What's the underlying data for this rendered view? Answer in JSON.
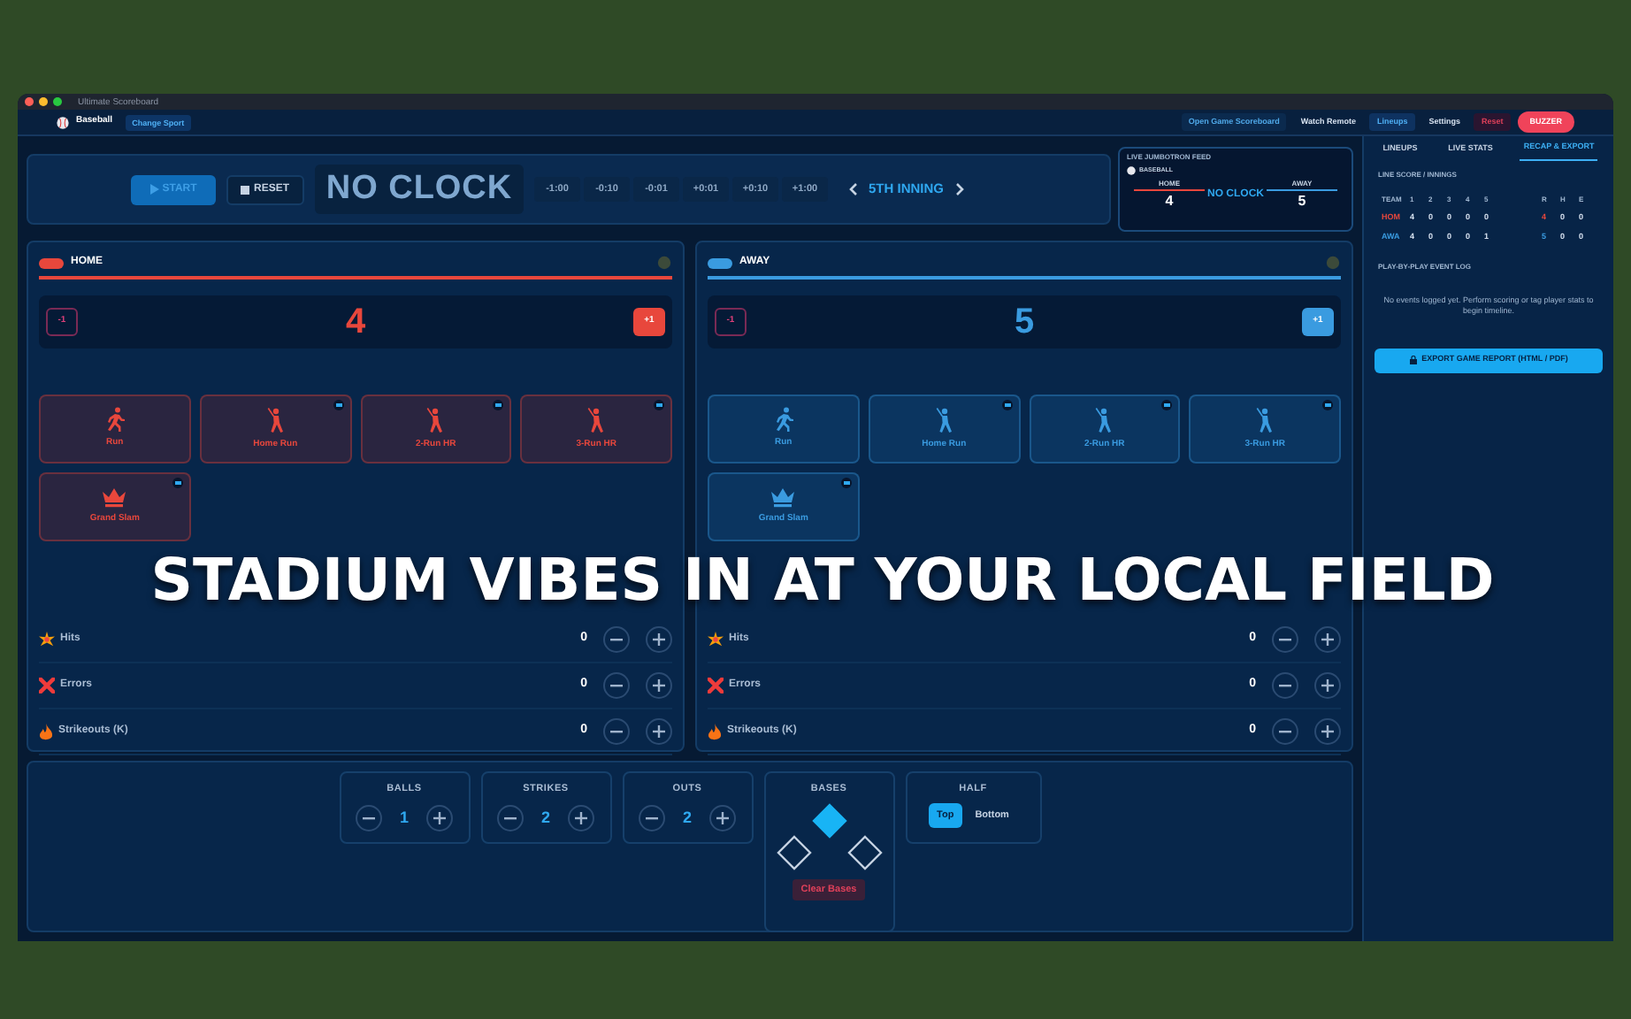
{
  "window": {
    "title": "Ultimate Scoreboard"
  },
  "top_bar": {
    "sport": "Baseball",
    "change_sport": "Change Sport",
    "buttons": [
      {
        "label": "Open Game Scoreboard",
        "kind": "link",
        "selected": false
      },
      {
        "label": "Watch Remote",
        "kind": "plain",
        "selected": false
      },
      {
        "label": "Lineups",
        "kind": "plain",
        "selected": true
      },
      {
        "label": "Settings",
        "kind": "plain",
        "selected": false
      },
      {
        "label": "Reset",
        "kind": "danger",
        "selected": false
      },
      {
        "label": "BUZZER",
        "kind": "buzzer",
        "selected": false
      }
    ]
  },
  "clock": {
    "start": "START",
    "reset": "RESET",
    "display": "NO CLOCK",
    "adjust": [
      "-1:00",
      "-0:10",
      "-0:01",
      "+0:01",
      "+0:10",
      "+1:00"
    ],
    "period": "5TH INNING"
  },
  "jumbotron": {
    "title": "LIVE JUMBOTRON FEED",
    "sport": "BASEBALL",
    "home_label": "HOME",
    "home_score": "4",
    "clock": "NO CLOCK",
    "away_label": "AWAY",
    "away_score": "5"
  },
  "teams": [
    {
      "name": "HOME",
      "color": "#e8473c",
      "score": "4",
      "minus": "-1",
      "plus": "+1",
      "actions": [
        {
          "label": "Run",
          "kind": "runner",
          "video": false
        },
        {
          "label": "Home Run",
          "kind": "batter",
          "video": true
        },
        {
          "label": "2-Run HR",
          "kind": "batter",
          "video": true
        },
        {
          "label": "3-Run HR",
          "kind": "batter",
          "video": true
        },
        {
          "label": "Grand Slam",
          "kind": "crown",
          "video": true
        }
      ],
      "stats": [
        {
          "label": "Hits",
          "kind": "hits",
          "value": "0"
        },
        {
          "label": "Errors",
          "kind": "errors",
          "value": "0"
        },
        {
          "label": "Strikeouts (K)",
          "kind": "strikeouts",
          "value": "0"
        }
      ]
    },
    {
      "name": "AWAY",
      "color": "#3a9be0",
      "score": "5",
      "minus": "-1",
      "plus": "+1",
      "actions": [
        {
          "label": "Run",
          "kind": "runner",
          "video": false
        },
        {
          "label": "Home Run",
          "kind": "batter",
          "video": true
        },
        {
          "label": "2-Run HR",
          "kind": "batter",
          "video": true
        },
        {
          "label": "3-Run HR",
          "kind": "batter",
          "video": true
        },
        {
          "label": "Grand Slam",
          "kind": "crown",
          "video": true
        }
      ],
      "stats": [
        {
          "label": "Hits",
          "kind": "hits",
          "value": "0"
        },
        {
          "label": "Errors",
          "kind": "errors",
          "value": "0"
        },
        {
          "label": "Strikeouts (K)",
          "kind": "strikeouts",
          "value": "0"
        }
      ]
    }
  ],
  "count": [
    {
      "label": "BALLS",
      "value": "1"
    },
    {
      "label": "STRIKES",
      "value": "2"
    },
    {
      "label": "OUTS",
      "value": "2"
    }
  ],
  "bases": {
    "label": "BASES",
    "third": false,
    "second": true,
    "first": false,
    "clear": "Clear Bases"
  },
  "half": {
    "label": "HALF",
    "options": [
      {
        "label": "Top",
        "selected": true
      },
      {
        "label": "Bottom",
        "selected": false
      }
    ]
  },
  "sidebar": {
    "tabs": [
      {
        "label": "LINEUPS",
        "selected": false
      },
      {
        "label": "LIVE STATS",
        "selected": false
      },
      {
        "label": "RECAP & EXPORT",
        "selected": true
      }
    ],
    "line_score": {
      "title": "LINE SCORE / INNINGS",
      "columns": [
        "TEAM",
        "1",
        "2",
        "3",
        "4",
        "5",
        "R",
        "H",
        "E"
      ],
      "rows": [
        {
          "color": "#e8473c",
          "cells": [
            "HOM",
            "4",
            "0",
            "0",
            "0",
            "0",
            "4",
            "0",
            "0"
          ]
        },
        {
          "color": "#3a9be0",
          "cells": [
            "AWA",
            "4",
            "0",
            "0",
            "0",
            "1",
            "5",
            "0",
            "0"
          ]
        }
      ]
    },
    "log_title": "PLAY-BY-PLAY EVENT LOG",
    "log_empty": "No events logged yet. Perform scoring or tag player stats to begin timeline.",
    "export": "EXPORT GAME REPORT (HTML / PDF)"
  },
  "headline": "STADIUM VIBES IN AT YOUR LOCAL FIELD"
}
